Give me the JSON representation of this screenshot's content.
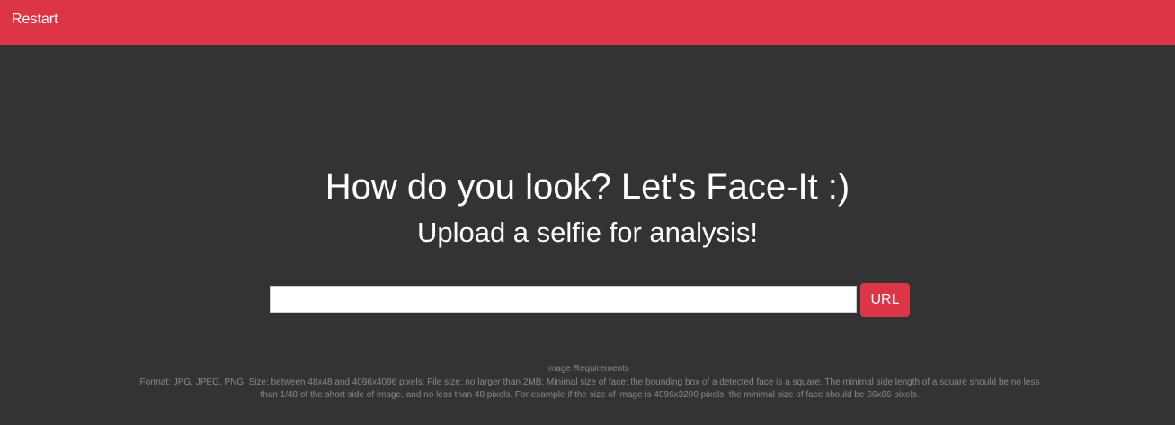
{
  "header": {
    "restart_label": "Restart",
    "bg_color": "#dc3545"
  },
  "main": {
    "headline": "How do you look? Let's Face-It :)",
    "subheadline": "Upload a selfie for analysis!",
    "url_input": {
      "value": "",
      "placeholder": ""
    },
    "url_button_label": "URL"
  },
  "requirements": {
    "title": "Image Requirements",
    "text": "Format: JPG, JPEG, PNG; Size: between 48x48 and 4096x4096 pixels; File size: no larger than 2MB; Minimal size of face: the bounding box of a detected face is a square. The minimal side length of a square should be no less than 1/48 of the short side of image, and no less than 48 pixels. For example if the size of image is 4096x3200 pixels, the minimal size of face should be 66x66 pixels."
  },
  "colors": {
    "background": "#333333",
    "accent": "#dc3545",
    "muted_text": "#8a8a8a"
  }
}
